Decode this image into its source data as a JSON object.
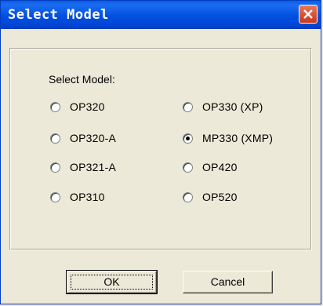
{
  "window": {
    "title": "Select Model",
    "close_label": "×"
  },
  "group": {
    "label": "Select Model:"
  },
  "options": [
    {
      "label": "OP320",
      "checked": false
    },
    {
      "label": "OP320-A",
      "checked": false
    },
    {
      "label": "OP321-A",
      "checked": false
    },
    {
      "label": "OP310",
      "checked": false
    },
    {
      "label": "OP330 (XP)",
      "checked": false
    },
    {
      "label": "MP330 (XMP)",
      "checked": true
    },
    {
      "label": "OP420",
      "checked": false
    },
    {
      "label": "OP520",
      "checked": false
    }
  ],
  "buttons": {
    "ok_label": "OK",
    "cancel_label": "Cancel"
  }
}
